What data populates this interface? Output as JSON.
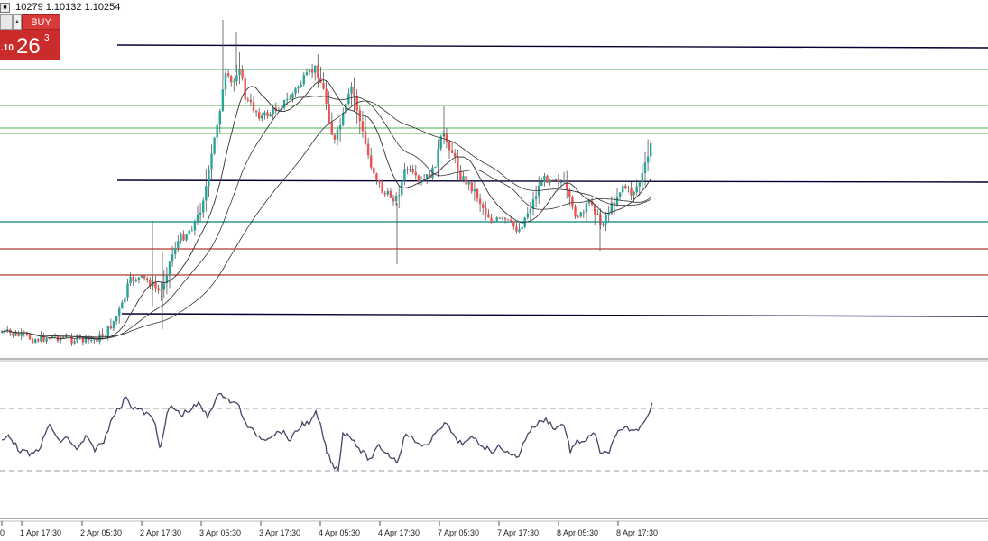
{
  "quote": {
    "text": ".10279 1.10132 1.10254"
  },
  "trade_panel": {
    "buy_label": "BUY",
    "price_prefix": ".10",
    "price_big": "26",
    "price_sup": "3"
  },
  "colors": {
    "bull": "#26a69a",
    "bear": "#ef5350",
    "level_dark": "#000033",
    "level_green": "#4caf50",
    "level_teal": "#008080",
    "level_red": "#b03a2e",
    "ma": "#333333",
    "rsi": "#444466"
  },
  "time_axis": {
    "labels": [
      "0",
      "1 Apr 17:30",
      "2 Apr 05:30",
      "2 Apr 17:30",
      "3 Apr 05:30",
      "3 Apr 17:30",
      "4 Apr 05:30",
      "4 Apr 17:30",
      "7 Apr 05:30",
      "7 Apr 17:30",
      "8 Apr 05:30",
      "8 Apr 17:30"
    ]
  }
}
